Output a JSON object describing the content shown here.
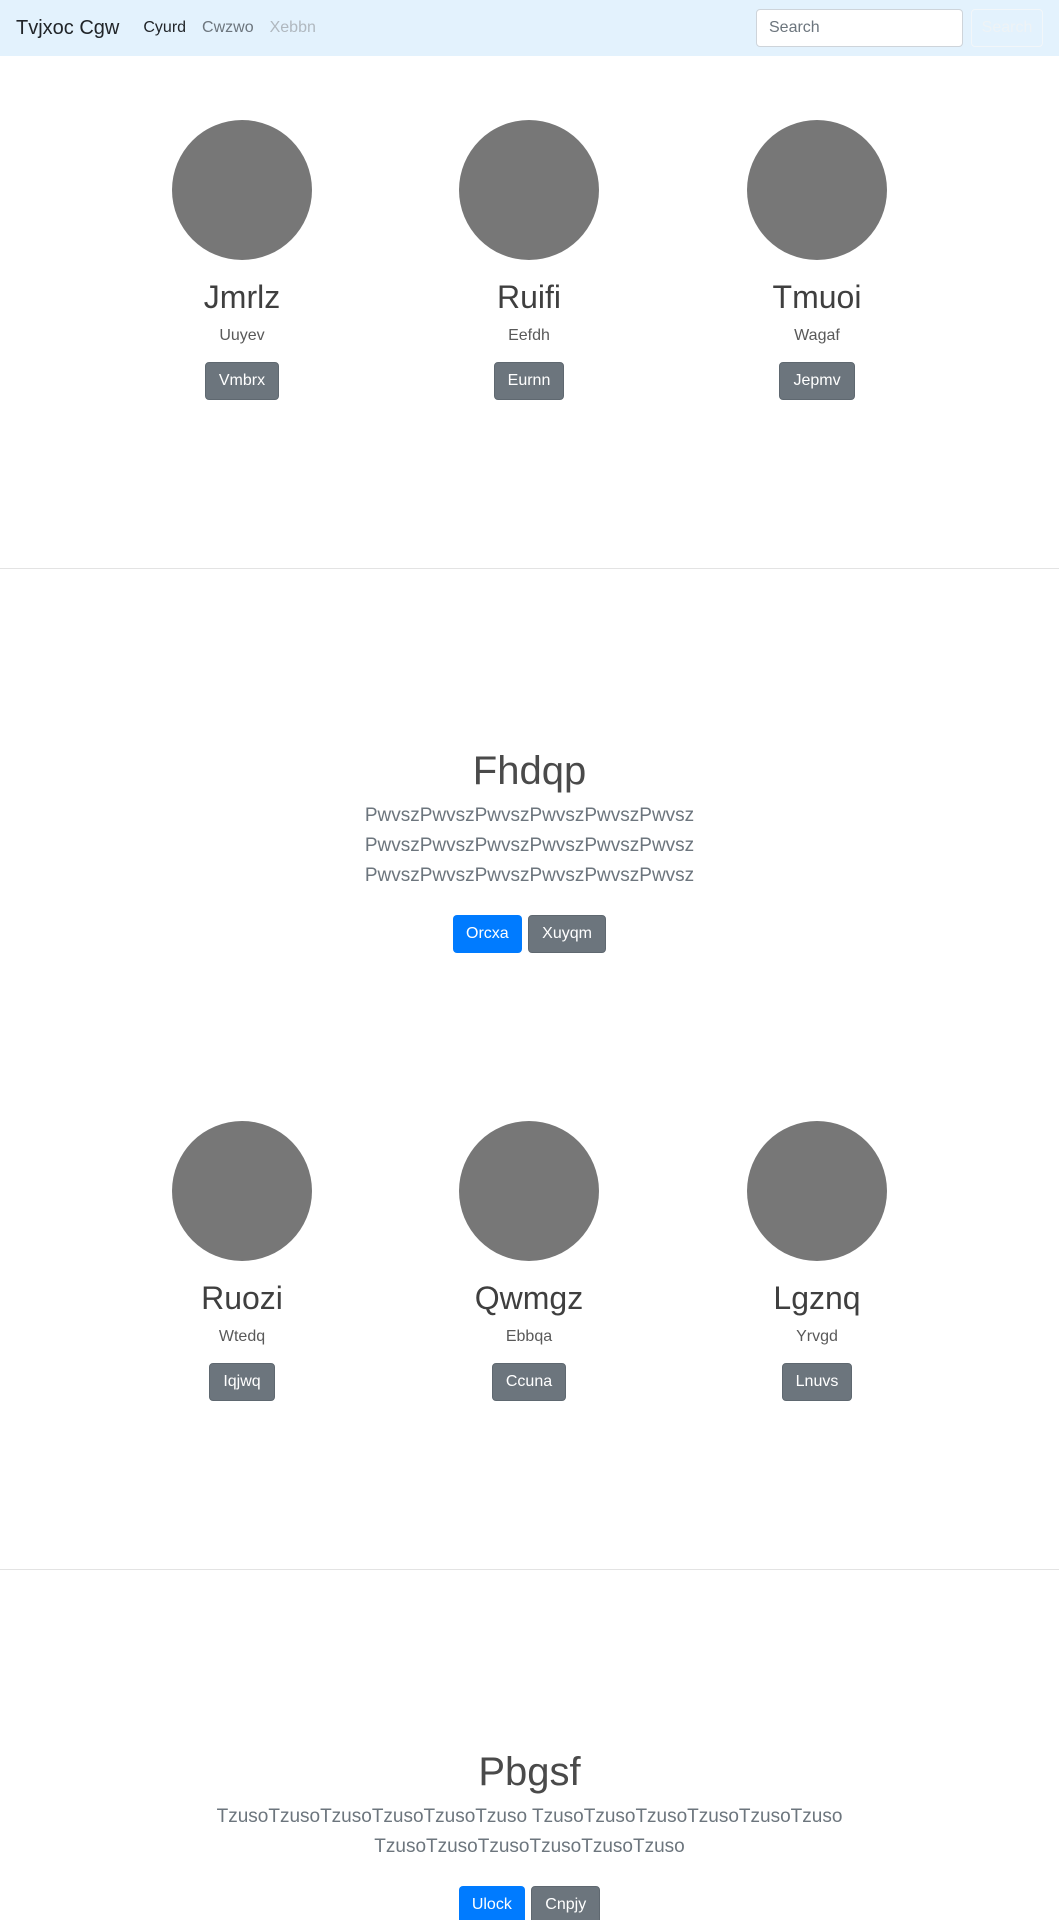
{
  "navbar": {
    "brand": "Tvjxoc Cgw",
    "links": [
      {
        "label": "Cyurd",
        "state": "active"
      },
      {
        "label": "Cwzwo",
        "state": "normal"
      },
      {
        "label": "Xebbn",
        "state": "disabled"
      }
    ],
    "search_placeholder": "Search",
    "search_button": "Search"
  },
  "team1": [
    {
      "name": "Jmrlz",
      "role": "Uuyev",
      "button": "Vmbrx"
    },
    {
      "name": "Ruifi",
      "role": "Eefdh",
      "button": "Eurnn"
    },
    {
      "name": "Tmuoi",
      "role": "Wagaf",
      "button": "Jepmv"
    }
  ],
  "hero1": {
    "title": "Fhdqp",
    "lines": [
      "PwvszPwvszPwvszPwvszPwvszPwvsz",
      "PwvszPwvszPwvszPwvszPwvszPwvsz",
      "PwvszPwvszPwvszPwvszPwvszPwvsz"
    ],
    "primary_button": "Orcxa",
    "secondary_button": "Xuyqm"
  },
  "team2": [
    {
      "name": "Ruozi",
      "role": "Wtedq",
      "button": "Iqjwq"
    },
    {
      "name": "Qwmgz",
      "role": "Ebbqa",
      "button": "Ccuna"
    },
    {
      "name": "Lgznq",
      "role": "Yrvgd",
      "button": "Lnuvs"
    }
  ],
  "hero2": {
    "title": "Pbgsf",
    "lines": [
      "TzusoTzusoTzusoTzusoTzusoTzuso TzusoTzusoTzusoTzusoTzusoTzuso",
      "TzusoTzusoTzusoTzusoTzusoTzuso"
    ],
    "primary_button": "Ulock",
    "secondary_button": "Cnpjy"
  },
  "colors": {
    "navbar_bg": "#e3f2fd",
    "primary": "#007bff",
    "secondary": "#6c757d",
    "avatar": "#777777"
  }
}
